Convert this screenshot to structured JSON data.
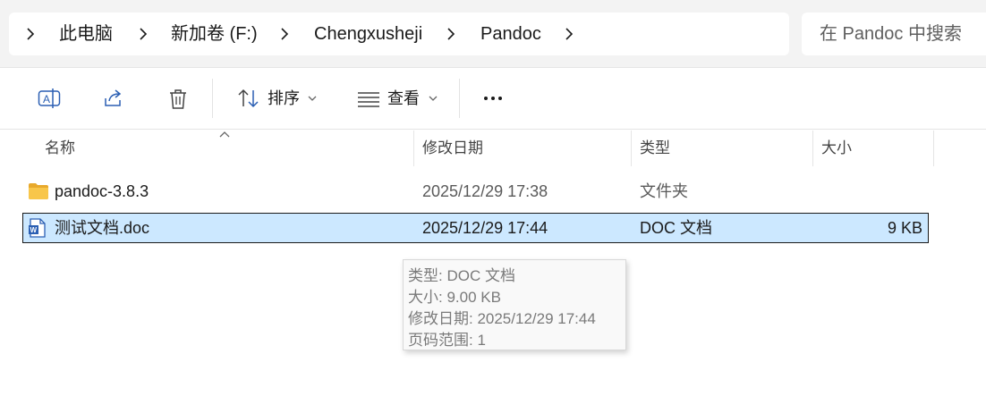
{
  "breadcrumb": {
    "items": [
      "此电脑",
      "新加卷 (F:)",
      "Chengxusheji",
      "Pandoc"
    ]
  },
  "search": {
    "placeholder": "在 Pandoc 中搜索"
  },
  "toolbar": {
    "rename_icon": "rename-icon",
    "share_icon": "share-icon",
    "delete_icon": "trash-icon",
    "sort_label": "排序",
    "view_label": "查看",
    "more_icon": "more-dots-icon"
  },
  "columns": {
    "name": "名称",
    "modified": "修改日期",
    "type": "类型",
    "size": "大小"
  },
  "files": [
    {
      "name": "pandoc-3.8.3",
      "modified": "2025/12/29 17:38",
      "type": "文件夹",
      "size": "",
      "icon": "folder-icon",
      "selected": false
    },
    {
      "name": "测试文档.doc",
      "modified": "2025/12/29 17:44",
      "type": "DOC 文档",
      "size": "9 KB",
      "icon": "word-document-icon",
      "selected": true
    }
  ],
  "tooltip": {
    "type": "类型: DOC 文档",
    "size": "大小: 9.00 KB",
    "modified": "修改日期: 2025/12/29 17:44",
    "pages": "页码范围: 1"
  },
  "colors": {
    "selection_bg": "#cce8ff",
    "folder": "#f8c64a",
    "word": "#2b5fb3"
  }
}
